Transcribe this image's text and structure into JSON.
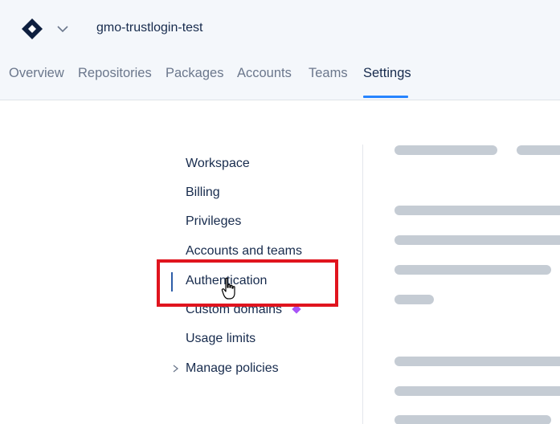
{
  "header": {
    "workspace_name": "gmo-trustlogin-test",
    "logo_icon": "diamond-logo-icon",
    "switcher_icon": "chevron-down-icon"
  },
  "tabs": [
    {
      "label": "Overview",
      "active": false
    },
    {
      "label": "Repositories",
      "active": false
    },
    {
      "label": "Packages",
      "active": false
    },
    {
      "label": "Accounts",
      "active": false
    },
    {
      "label": "Teams",
      "active": false
    },
    {
      "label": "Settings",
      "active": true
    }
  ],
  "settings_nav": {
    "items": [
      {
        "label": "Workspace"
      },
      {
        "label": "Billing"
      },
      {
        "label": "Privileges"
      },
      {
        "label": "Accounts and teams"
      },
      {
        "label": "Authentication",
        "selected": true
      },
      {
        "label": "Custom domains",
        "badge_icon": "purple-diamond-icon"
      },
      {
        "label": "Usage limits"
      },
      {
        "label": "Manage policies",
        "expandable": true
      }
    ]
  },
  "colors": {
    "accent": "#2684ff",
    "highlight": "#e0141e",
    "premium_badge": "#a855f7"
  }
}
